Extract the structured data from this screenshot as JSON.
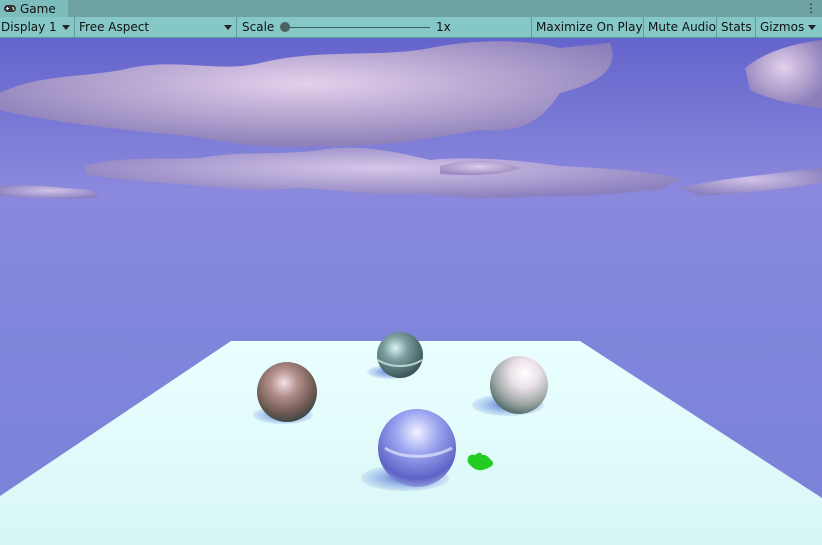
{
  "window": {
    "tab_title": "Game",
    "tab_icon": "gamepad-icon",
    "menu_icon": "kebab-menu-icon"
  },
  "toolbar": {
    "display": "Display 1",
    "aspect": "Free Aspect",
    "scale_label": "Scale",
    "scale_value": "1x",
    "maximize": "Maximize On Play",
    "mute": "Mute Audio",
    "stats": "Stats",
    "gizmos": "Gizmos"
  },
  "colors": {
    "toolbar_bg": "#86c8c8",
    "sky_top": "#6c6ad0",
    "sky_horizon": "#8f8ee0",
    "floor": "#e6fbfb",
    "hand_cursor": "#22cc22"
  },
  "scene": {
    "objects": [
      "copper-sphere",
      "teal-sphere",
      "white-sphere",
      "blue-sphere"
    ],
    "cursor": "hand-cursor-icon"
  }
}
